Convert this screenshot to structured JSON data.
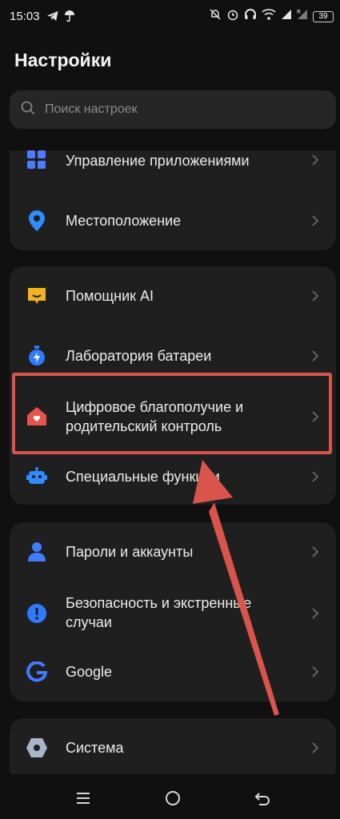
{
  "status_bar": {
    "time": "15:03",
    "battery": "39",
    "icons_left": [
      "telegram-icon",
      "umbrella-icon"
    ],
    "icons_right": [
      "mute-icon",
      "alarm-icon",
      "headphones-icon",
      "wifi-icon",
      "signal-icon",
      "signal-roaming-icon"
    ]
  },
  "header": {
    "title": "Настройки"
  },
  "search": {
    "placeholder": "Поиск настроек"
  },
  "groups": [
    {
      "items": [
        {
          "label": "Управление приложениями",
          "icon": "apps-grid-icon",
          "color": "#4f7cff"
        },
        {
          "label": "Местоположение",
          "icon": "location-pin-icon",
          "color": "#2f8cff"
        }
      ]
    },
    {
      "items": [
        {
          "label": "Помощник AI",
          "icon": "ai-assistant-icon",
          "color": "#f2b321"
        },
        {
          "label": "Лаборатория батареи",
          "icon": "battery-lab-icon",
          "color": "#2f7bff"
        },
        {
          "label": "Цифровое благополучие и родительский контроль",
          "line1": "Цифровое благополучие и",
          "line2": "родительский контроль",
          "icon": "digital-wellbeing-icon",
          "color": "#e8524f"
        },
        {
          "label": "Специальные функции",
          "icon": "accessibility-robot-icon",
          "color": "#2f8cff"
        }
      ]
    },
    {
      "items": [
        {
          "label": "Пароли и аккаунты",
          "icon": "accounts-person-icon",
          "color": "#3f7cff"
        },
        {
          "label": "Безопасность и экстренные случаи",
          "line1": "Безопасность и экстренные",
          "line2": "случаи",
          "icon": "emergency-alert-icon",
          "color": "#2f7bff"
        },
        {
          "label": "Google",
          "icon": "google-icon",
          "color": "#3f7cff"
        }
      ]
    },
    {
      "items": [
        {
          "label": "Система",
          "icon": "system-hex-icon",
          "color": "#aab4c8"
        }
      ]
    }
  ],
  "annotation": {
    "highlight_color": "#d9544a"
  }
}
